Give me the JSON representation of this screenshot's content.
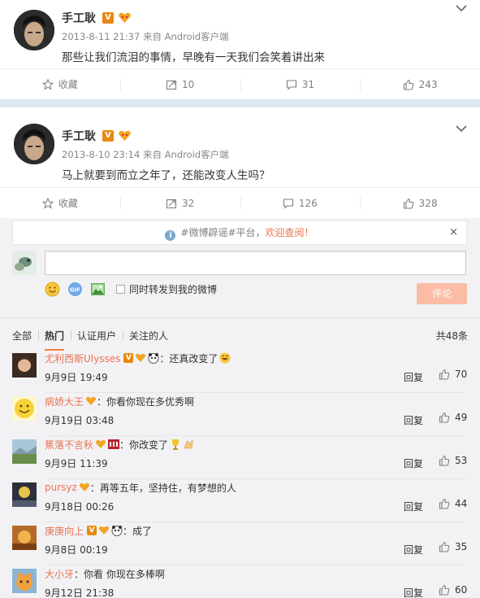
{
  "posts": [
    {
      "author": "手工耿",
      "meta": "2013-8-11 21:37 来自 Android客户端",
      "content": "那些让我们流泪的事情，早晚有一天我们会笑着讲出来",
      "actions": {
        "favorite": "收藏",
        "repost": "10",
        "comment": "31",
        "like": "243"
      }
    },
    {
      "author": "手工耿",
      "meta": "2013-8-10 23:14 来自 Android客户端",
      "content": "马上就要到而立之年了，还能改变人生吗？",
      "actions": {
        "favorite": "收藏",
        "repost": "32",
        "comment": "126",
        "like": "328"
      }
    }
  ],
  "notice": {
    "prefix": "#微博辟谣#平台，",
    "link": "欢迎查阅！",
    "close": "×"
  },
  "composer": {
    "forward_label": "同时转发到我的微博",
    "submit": "评论"
  },
  "filters": [
    "全部",
    "热门",
    "认证用户",
    "关注的人"
  ],
  "total": "共48条",
  "comments": [
    {
      "user": "尤利西斯Ulysses",
      "sep": "：",
      "text": "还真改变了",
      "time": "9月9日 19:49",
      "reply": "回复",
      "likes": "70"
    },
    {
      "user": "病娇大王",
      "sep": "：",
      "text": "你看你现在多优秀啊",
      "time": "9月19日 03:48",
      "reply": "回复",
      "likes": "49"
    },
    {
      "user": "蕉落不言秋",
      "sep": "：",
      "text": "你改变了",
      "time": "9月9日 11:39",
      "reply": "回复",
      "likes": "53"
    },
    {
      "user": "pursyz",
      "sep": "：",
      "text": "再等五年，坚持住，有梦想的人",
      "time": "9月18日 00:26",
      "reply": "回复",
      "likes": "44"
    },
    {
      "user": "庚庚向上",
      "sep": "：",
      "text": "成了",
      "time": "9月8日 00:19",
      "reply": "回复",
      "likes": "35"
    },
    {
      "user": "大小牙",
      "sep": "：",
      "text": "你看 你现在多棒啊",
      "time": "9月12日 21:38",
      "reply": "回复",
      "likes": "60"
    }
  ],
  "colors": {
    "accent": "#eb7350",
    "verified": "#e8880f",
    "separator": "#dbe7f2",
    "submit": "#fbbca5"
  }
}
